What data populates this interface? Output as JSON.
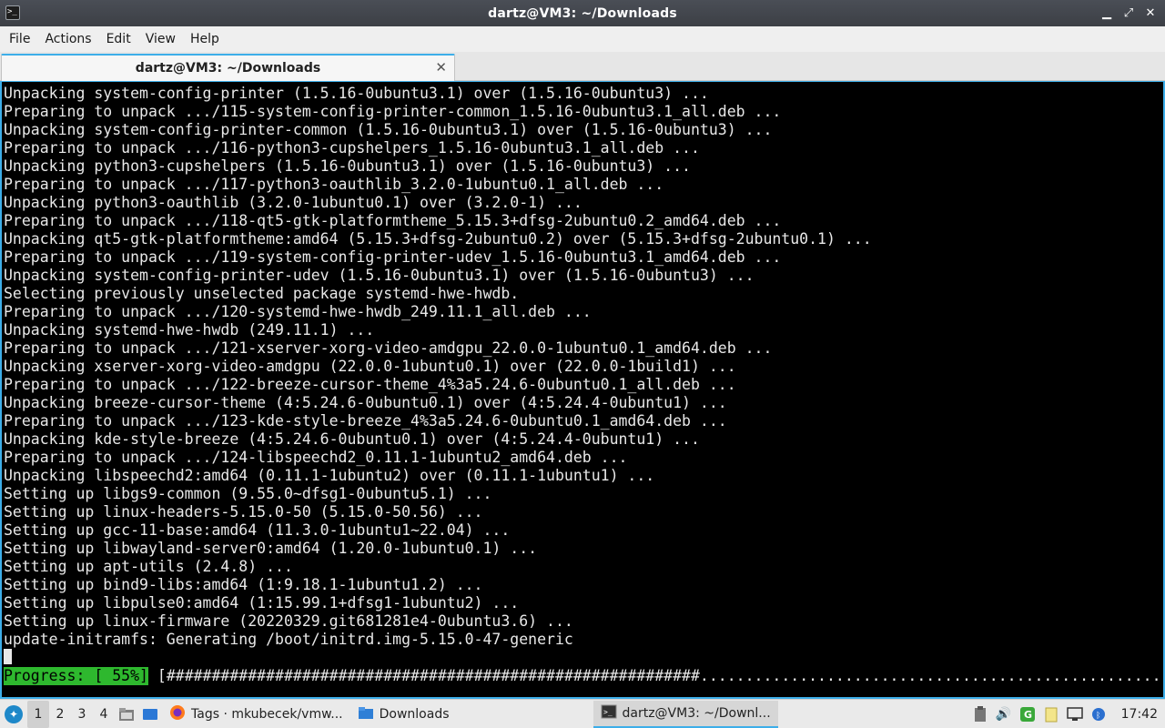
{
  "window": {
    "title": "dartz@VM3: ~/Downloads",
    "controls": [
      "minimize",
      "maximize",
      "close"
    ]
  },
  "menubar": {
    "items": [
      "File",
      "Actions",
      "Edit",
      "View",
      "Help"
    ]
  },
  "tabs": [
    {
      "label": "dartz@VM3: ~/Downloads"
    }
  ],
  "terminal": {
    "lines": [
      "Unpacking system-config-printer (1.5.16-0ubuntu3.1) over (1.5.16-0ubuntu3) ...",
      "Preparing to unpack .../115-system-config-printer-common_1.5.16-0ubuntu3.1_all.deb ...",
      "Unpacking system-config-printer-common (1.5.16-0ubuntu3.1) over (1.5.16-0ubuntu3) ...",
      "Preparing to unpack .../116-python3-cupshelpers_1.5.16-0ubuntu3.1_all.deb ...",
      "Unpacking python3-cupshelpers (1.5.16-0ubuntu3.1) over (1.5.16-0ubuntu3) ...",
      "Preparing to unpack .../117-python3-oauthlib_3.2.0-1ubuntu0.1_all.deb ...",
      "Unpacking python3-oauthlib (3.2.0-1ubuntu0.1) over (3.2.0-1) ...",
      "Preparing to unpack .../118-qt5-gtk-platformtheme_5.15.3+dfsg-2ubuntu0.2_amd64.deb ...",
      "Unpacking qt5-gtk-platformtheme:amd64 (5.15.3+dfsg-2ubuntu0.2) over (5.15.3+dfsg-2ubuntu0.1) ...",
      "Preparing to unpack .../119-system-config-printer-udev_1.5.16-0ubuntu3.1_amd64.deb ...",
      "Unpacking system-config-printer-udev (1.5.16-0ubuntu3.1) over (1.5.16-0ubuntu3) ...",
      "Selecting previously unselected package systemd-hwe-hwdb.",
      "Preparing to unpack .../120-systemd-hwe-hwdb_249.11.1_all.deb ...",
      "Unpacking systemd-hwe-hwdb (249.11.1) ...",
      "Preparing to unpack .../121-xserver-xorg-video-amdgpu_22.0.0-1ubuntu0.1_amd64.deb ...",
      "Unpacking xserver-xorg-video-amdgpu (22.0.0-1ubuntu0.1) over (22.0.0-1build1) ...",
      "Preparing to unpack .../122-breeze-cursor-theme_4%3a5.24.6-0ubuntu0.1_all.deb ...",
      "Unpacking breeze-cursor-theme (4:5.24.6-0ubuntu0.1) over (4:5.24.4-0ubuntu1) ...",
      "Preparing to unpack .../123-kde-style-breeze_4%3a5.24.6-0ubuntu0.1_amd64.deb ...",
      "Unpacking kde-style-breeze (4:5.24.6-0ubuntu0.1) over (4:5.24.4-0ubuntu1) ...",
      "Preparing to unpack .../124-libspeechd2_0.11.1-1ubuntu2_amd64.deb ...",
      "Unpacking libspeechd2:amd64 (0.11.1-1ubuntu2) over (0.11.1-1ubuntu1) ...",
      "Setting up libgs9-common (9.55.0~dfsg1-0ubuntu5.1) ...",
      "Setting up linux-headers-5.15.0-50 (5.15.0-50.56) ...",
      "Setting up gcc-11-base:amd64 (11.3.0-1ubuntu1~22.04) ...",
      "Setting up libwayland-server0:amd64 (1.20.0-1ubuntu0.1) ...",
      "Setting up apt-utils (2.4.8) ...",
      "Setting up bind9-libs:amd64 (1:9.18.1-1ubuntu1.2) ...",
      "Setting up libpulse0:amd64 (1:15.99.1+dfsg1-1ubuntu2) ...",
      "Setting up linux-firmware (20220329.git681281e4-0ubuntu3.6) ...",
      "update-initramfs: Generating /boot/initrd.img-5.15.0-47-generic"
    ],
    "progress_label": "Progress: [ 55%]",
    "progress_bar": " [###########################################################...................................................]",
    "progress_percent": 55
  },
  "taskbar": {
    "desktops": [
      "1",
      "2",
      "3",
      "4"
    ],
    "active_desktop": "1",
    "launchers": [
      "file-manager-icon",
      "show-desktop-icon"
    ],
    "tasks": [
      {
        "label": "Tags · mkubecek/vmw...",
        "icon": "firefox-icon"
      },
      {
        "label": "Downloads",
        "icon": "folder-icon"
      },
      {
        "label": "dartz@VM3: ~/Downl...",
        "icon": "terminal-icon"
      }
    ],
    "tray": [
      "clipboard-icon",
      "volume-icon",
      "update-icon",
      "notes-icon",
      "network-icon",
      "bluetooth-icon"
    ],
    "clock": "17:42"
  }
}
